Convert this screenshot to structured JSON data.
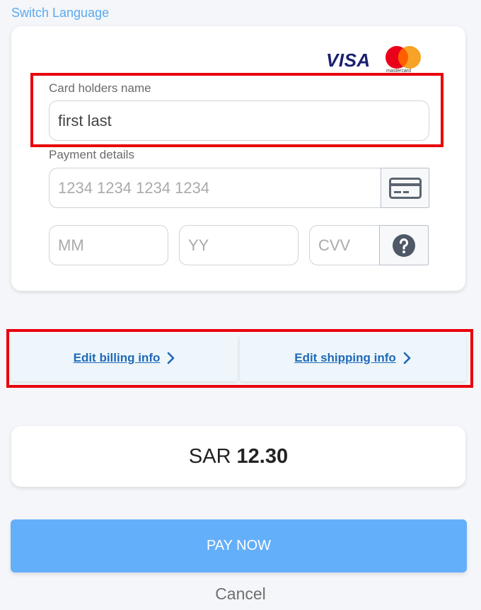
{
  "switch_language": "Switch Language",
  "brands": {
    "visa": "VISA",
    "mastercard": "mastercard"
  },
  "cardholder": {
    "label": "Card holders name",
    "value": "first last"
  },
  "payment": {
    "label": "Payment details",
    "card_placeholder": "1234 1234 1234 1234",
    "month_placeholder": "MM",
    "year_placeholder": "YY",
    "cvv_placeholder": "CVV"
  },
  "billing": {
    "label": "Edit billing info"
  },
  "shipping": {
    "label": "Edit shipping info"
  },
  "amount": {
    "currency": "SAR",
    "value": "12.30"
  },
  "pay_label": "PAY NOW",
  "cancel_label": "Cancel",
  "colors": {
    "accent": "#64affa",
    "link": "#1e69b8",
    "highlight": "#e8000b"
  }
}
